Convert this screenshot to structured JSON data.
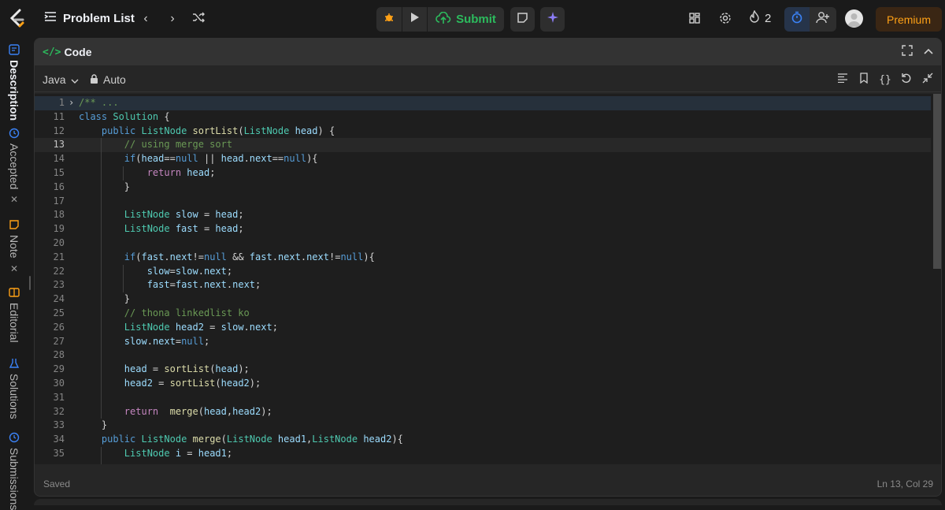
{
  "topbar": {
    "problem_list": "Problem List",
    "submit": "Submit",
    "streak": "2",
    "premium": "Premium"
  },
  "sidebar": {
    "tabs": [
      "Description",
      "Accepted",
      "Note",
      "Editorial",
      "Solutions",
      "Submissions"
    ]
  },
  "panel": {
    "title": "Code",
    "language": "Java",
    "mode": "Auto"
  },
  "editor": {
    "lines": [
      {
        "n": "1",
        "t": "/** ..."
      },
      {
        "n": "11",
        "t": "class Solution {"
      },
      {
        "n": "12",
        "t": "    public ListNode sortList(ListNode head) {"
      },
      {
        "n": "13",
        "t": "        // using merge sort"
      },
      {
        "n": "14",
        "t": "        if(head==null || head.next==null){"
      },
      {
        "n": "15",
        "t": "            return head;"
      },
      {
        "n": "16",
        "t": "        }"
      },
      {
        "n": "17",
        "t": ""
      },
      {
        "n": "18",
        "t": "        ListNode slow = head;"
      },
      {
        "n": "19",
        "t": "        ListNode fast = head;"
      },
      {
        "n": "20",
        "t": ""
      },
      {
        "n": "21",
        "t": "        if(fast.next!=null && fast.next.next!=null){"
      },
      {
        "n": "22",
        "t": "            slow=slow.next;"
      },
      {
        "n": "23",
        "t": "            fast=fast.next.next;"
      },
      {
        "n": "24",
        "t": "        }"
      },
      {
        "n": "25",
        "t": "        // thona linkedlist ko"
      },
      {
        "n": "26",
        "t": "        ListNode head2 = slow.next;"
      },
      {
        "n": "27",
        "t": "        slow.next=null;"
      },
      {
        "n": "28",
        "t": ""
      },
      {
        "n": "29",
        "t": "        head = sortList(head);"
      },
      {
        "n": "30",
        "t": "        head2 = sortList(head2);"
      },
      {
        "n": "31",
        "t": ""
      },
      {
        "n": "32",
        "t": "        return  merge(head,head2);"
      },
      {
        "n": "33",
        "t": "    }"
      },
      {
        "n": "34",
        "t": "    public ListNode merge(ListNode head1,ListNode head2){"
      },
      {
        "n": "35",
        "t": "        ListNode i = head1;"
      }
    ],
    "current_line_number": "13"
  },
  "status": {
    "saved": "Saved",
    "cursor": "Ln 13, Col 29"
  },
  "colors": {
    "accent": "#ffa116",
    "submit": "#2cbb5d",
    "timer": "#3b82f6"
  }
}
